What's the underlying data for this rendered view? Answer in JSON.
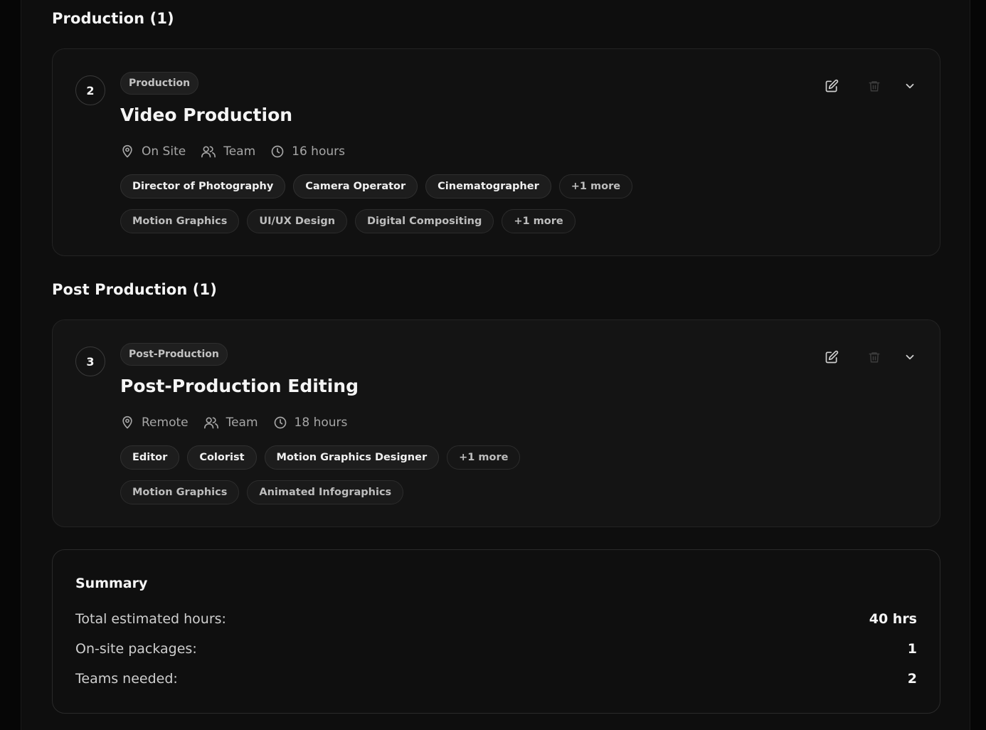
{
  "sections": [
    {
      "title": "Production (1)",
      "package": {
        "step": "2",
        "category": "Production",
        "title": "Video Production",
        "location": "On Site",
        "team": "Team",
        "hours": "16 hours",
        "roles": [
          "Director of Photography",
          "Camera Operator",
          "Cinematographer"
        ],
        "roles_more": "+1 more",
        "skills": [
          "Motion Graphics",
          "UI/UX Design",
          "Digital Compositing"
        ],
        "skills_more": "+1 more"
      }
    },
    {
      "title": "Post Production (1)",
      "package": {
        "step": "3",
        "category": "Post-Production",
        "title": "Post-Production Editing",
        "location": "Remote",
        "team": "Team",
        "hours": "18 hours",
        "roles": [
          "Editor",
          "Colorist",
          "Motion Graphics Designer"
        ],
        "roles_more": "+1 more",
        "skills": [
          "Motion Graphics",
          "Animated Infographics"
        ]
      }
    }
  ],
  "summary": {
    "title": "Summary",
    "rows": [
      {
        "label": "Total estimated hours:",
        "value": "40 hrs"
      },
      {
        "label": "On-site packages:",
        "value": "1"
      },
      {
        "label": "Teams needed:",
        "value": "2"
      }
    ]
  },
  "icons": {
    "location": "map-pin-icon",
    "team": "users-icon",
    "hours": "clock-icon",
    "edit": "edit-icon",
    "delete": "trash-icon",
    "expand": "chevron-down-icon"
  }
}
